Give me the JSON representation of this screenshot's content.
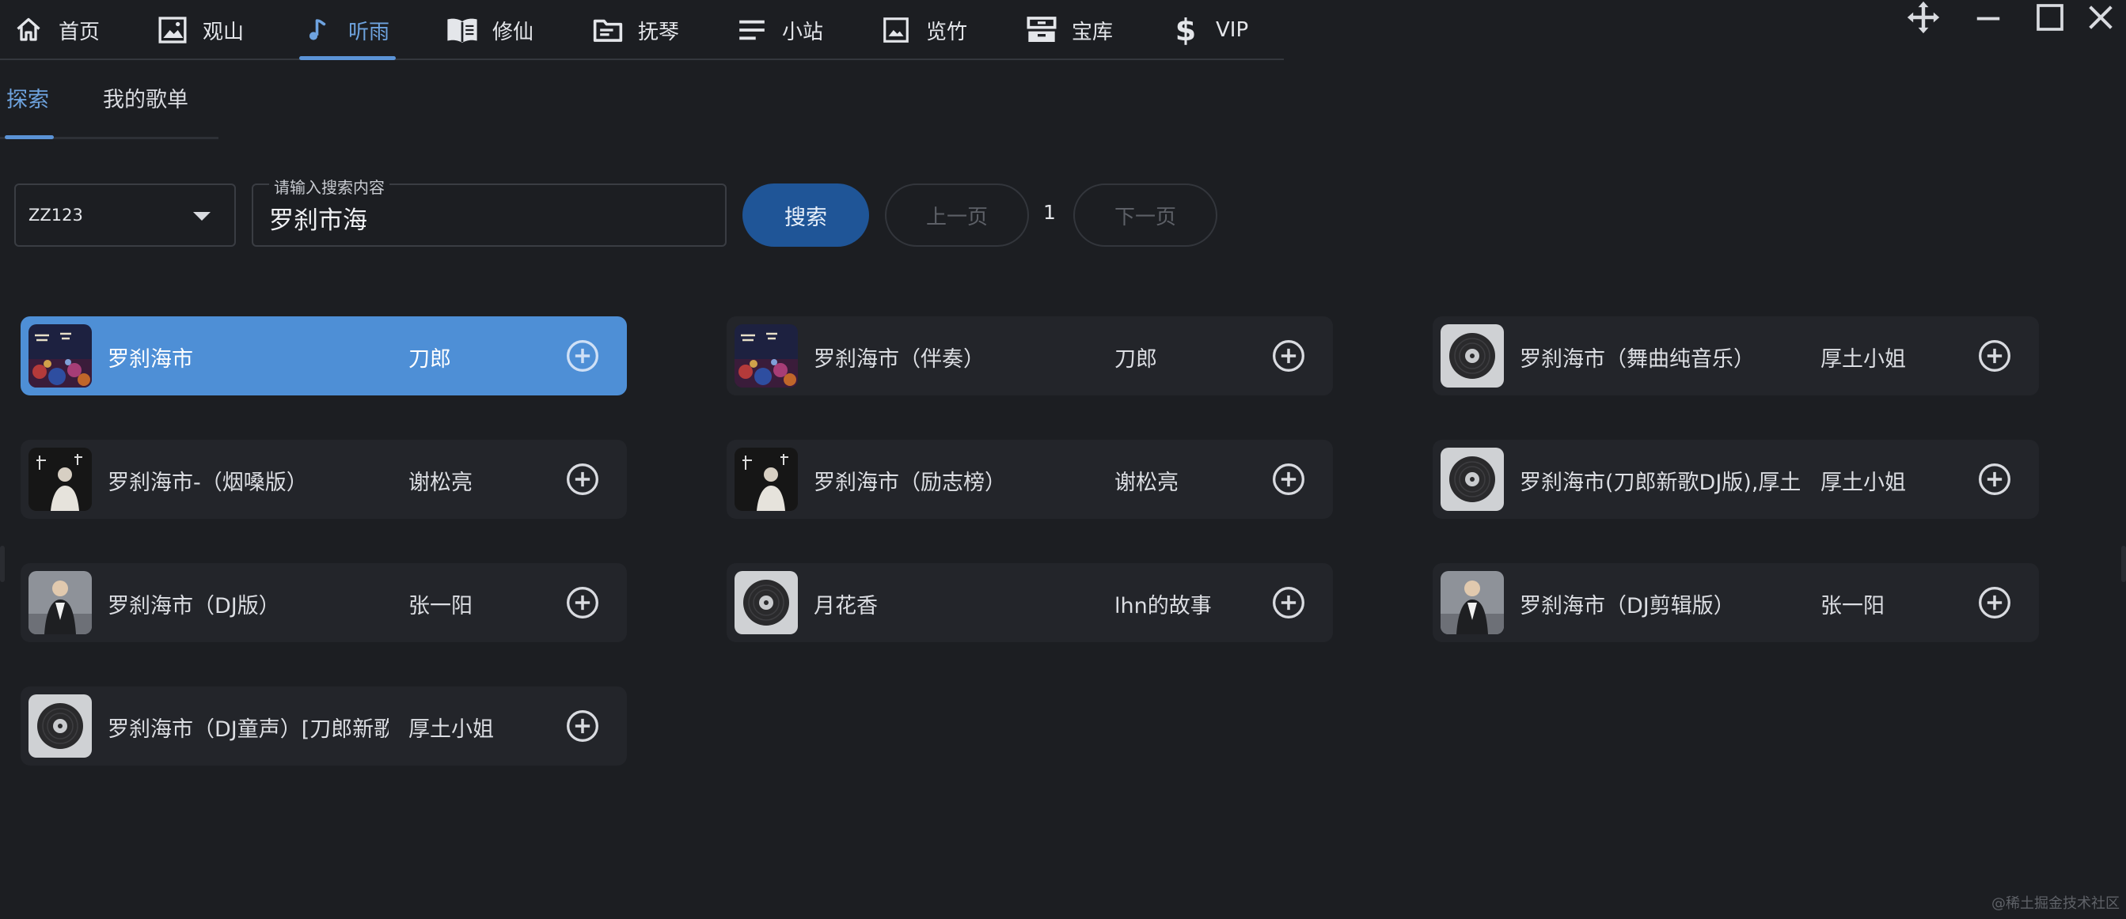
{
  "nav": {
    "items": [
      {
        "label": "首页",
        "icon": "home-icon"
      },
      {
        "label": "观山",
        "icon": "image-icon"
      },
      {
        "label": "听雨",
        "icon": "music-note-icon"
      },
      {
        "label": "修仙",
        "icon": "book-icon"
      },
      {
        "label": "抚琴",
        "icon": "folder-icon"
      },
      {
        "label": "小站",
        "icon": "menu-lines-icon"
      },
      {
        "label": "览竹",
        "icon": "picture-icon"
      },
      {
        "label": "宝库",
        "icon": "storage-icon"
      },
      {
        "label": "VIP",
        "icon": "dollar-icon"
      }
    ],
    "active": "听雨"
  },
  "window_controls": [
    "move-icon",
    "minimize-icon",
    "maximize-icon",
    "close-icon"
  ],
  "subtabs": {
    "items": [
      "探索",
      "我的歌单"
    ],
    "active": "探索"
  },
  "search": {
    "source": "ZZ123",
    "legend": "请输入搜索内容",
    "query": "罗刹市海",
    "button": "搜索",
    "prev": "上一页",
    "page": "1",
    "next": "下一页"
  },
  "songs": [
    {
      "title": "罗刹海市",
      "artist": "刀郎",
      "cover": "concert",
      "selected": true
    },
    {
      "title": "罗刹海市（伴奏）",
      "artist": "刀郎",
      "cover": "concert",
      "selected": false
    },
    {
      "title": "罗刹海市（舞曲纯音乐）",
      "artist": "厚土小姐",
      "cover": "vinyl",
      "selected": false
    },
    {
      "title": "罗刹海市-（烟嗓版）",
      "artist": "谢松亮",
      "cover": "portrait",
      "selected": false
    },
    {
      "title": "罗刹海市（励志榜）",
      "artist": "谢松亮",
      "cover": "portrait",
      "selected": false
    },
    {
      "title": "罗刹海市(刀郎新歌DJ版),厚土",
      "artist": "厚土小姐",
      "cover": "vinyl",
      "selected": false
    },
    {
      "title": "罗刹海市（DJ版）",
      "artist": "张一阳",
      "cover": "singer",
      "selected": false
    },
    {
      "title": "月花香",
      "artist": "lhn的故事",
      "cover": "vinyl",
      "selected": false
    },
    {
      "title": "罗刹海市（DJ剪辑版）",
      "artist": "张一阳",
      "cover": "singer",
      "selected": false
    },
    {
      "title": "罗刹海市（DJ童声）[刀郎新歌",
      "artist": "厚土小姐",
      "cover": "vinyl",
      "selected": false
    }
  ],
  "watermark": "@稀土掘金技术社区",
  "colors": {
    "accent": "#5b93d6",
    "selected_card": "#4e8fd6",
    "search_button": "#1f5597",
    "background": "#1c1e22",
    "card": "#23252a"
  }
}
